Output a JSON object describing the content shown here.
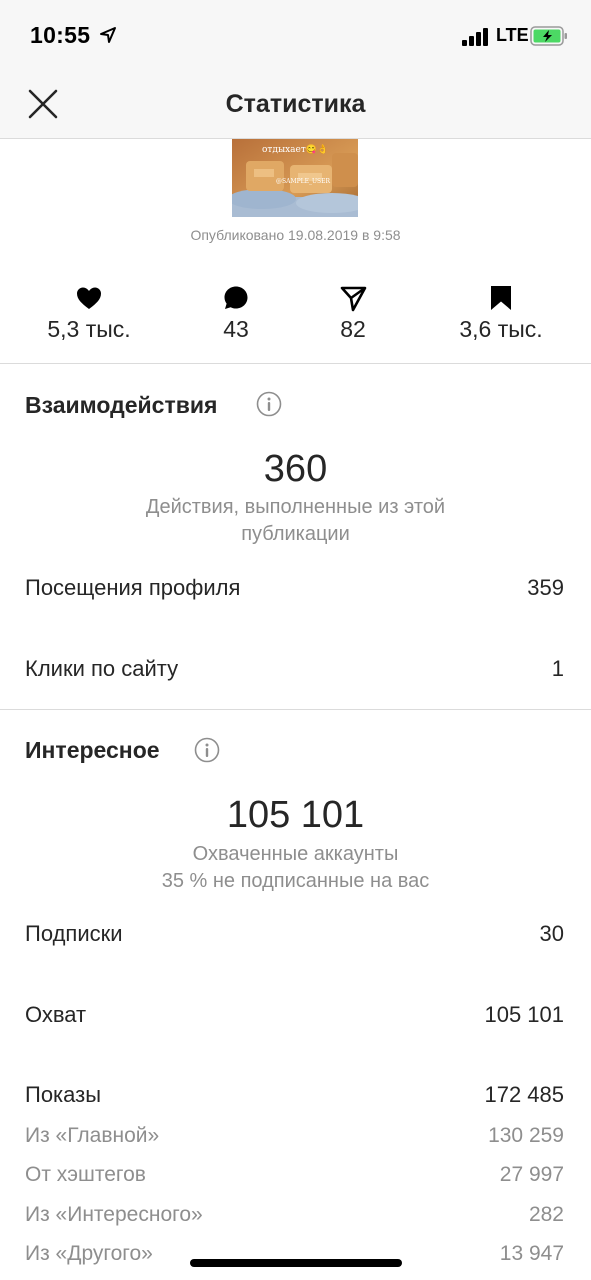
{
  "status_bar": {
    "time": "10:55",
    "network": "LTE"
  },
  "header": {
    "title": "Статистика"
  },
  "post": {
    "thumbnail_caption": "отдыхает😋👌",
    "thumbnail_tag": "@SAMPLE_USER",
    "published": "Опубликовано 19.08.2019 в 9:58"
  },
  "metrics": [
    {
      "icon": "heart-icon",
      "value": "5,3 тыс."
    },
    {
      "icon": "comment-icon",
      "value": "43"
    },
    {
      "icon": "share-icon",
      "value": "82"
    },
    {
      "icon": "bookmark-icon",
      "value": "3,6 тыс."
    }
  ],
  "interactions": {
    "title": "Взаимодействия",
    "total": "360",
    "description": "Действия, выполненные из этой публикации",
    "rows": [
      {
        "label": "Посещения профиля",
        "value": "359"
      },
      {
        "label": "Клики по сайту",
        "value": "1"
      }
    ]
  },
  "discovery": {
    "title": "Интересное",
    "total": "105 101",
    "description_line1": "Охваченные аккаунты",
    "description_line2": "35 % не подписанные на вас",
    "rows": [
      {
        "label": "Подписки",
        "value": "30"
      },
      {
        "label": "Охват",
        "value": "105 101"
      },
      {
        "label": "Показы",
        "value": "172 485"
      }
    ],
    "impression_sources": [
      {
        "label": "Из «Главной»",
        "value": "130 259"
      },
      {
        "label": "От хэштегов",
        "value": "27 997"
      },
      {
        "label": "Из «Интересного»",
        "value": "282"
      },
      {
        "label": "Из «Другого»",
        "value": "13 947"
      }
    ]
  },
  "colors": {
    "text_primary": "#262626",
    "text_secondary": "#8e8e8e",
    "divider": "#dbdbdb",
    "battery_charging": "#4cd964"
  }
}
